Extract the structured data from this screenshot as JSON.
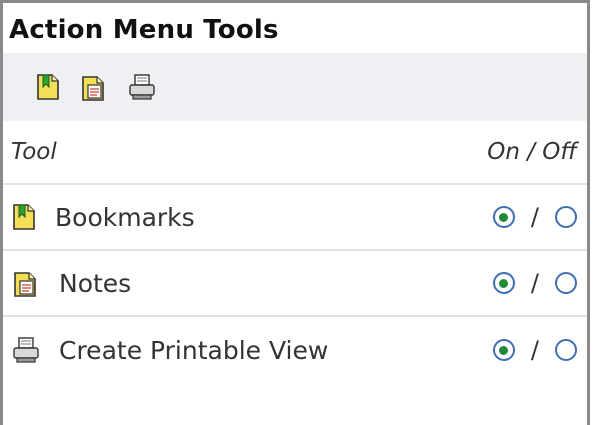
{
  "panel": {
    "title": "Action Menu Tools",
    "toolbar_icons": [
      "bookmark-icon",
      "notes-icon",
      "printer-icon"
    ],
    "header": {
      "tool_label": "Tool",
      "onoff_label": "On / Off"
    },
    "rows": [
      {
        "label": "Bookmarks",
        "icon": "bookmark-icon",
        "state": "on"
      },
      {
        "label": "Notes",
        "icon": "notes-icon",
        "state": "on"
      },
      {
        "label": "Create Printable View",
        "icon": "printer-icon",
        "state": "on"
      }
    ],
    "separator": "/"
  },
  "colors": {
    "accent_border": "#3f6fb0",
    "selected_dot": "#1f8a3a",
    "icon_yellow": "#f4de55",
    "icon_green": "#2fa12f",
    "toolbar_bg": "#eef0f3"
  }
}
